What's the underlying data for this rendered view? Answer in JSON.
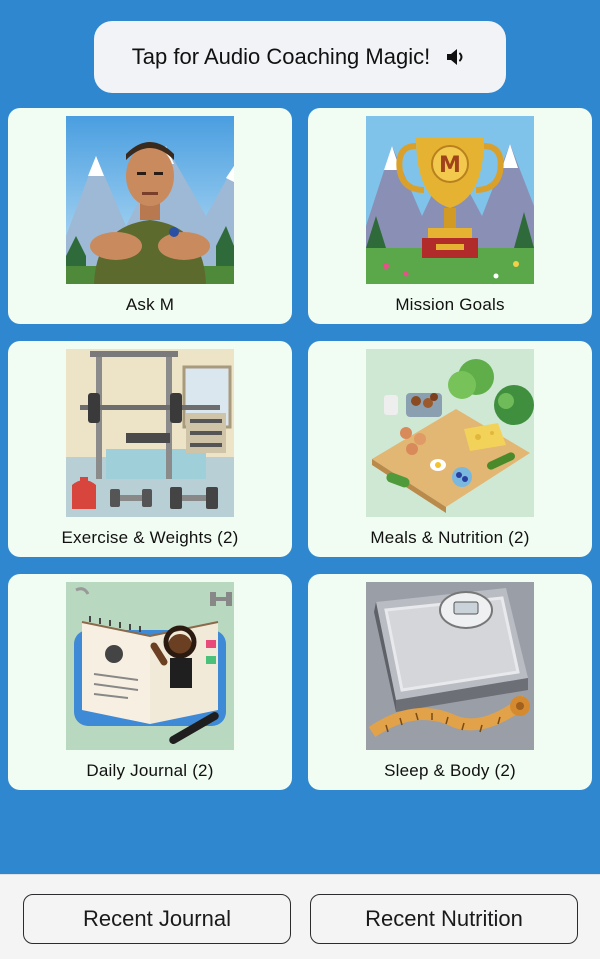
{
  "audio_button": {
    "label": "Tap for Audio Coaching Magic!",
    "icon": "speaker-icon"
  },
  "cards": [
    {
      "label": "Ask M",
      "image": "drill-sergeant-illustration"
    },
    {
      "label": "Mission Goals",
      "image": "trophy-illustration"
    },
    {
      "label": "Exercise & Weights (2)",
      "image": "gym-illustration"
    },
    {
      "label": "Meals & Nutrition (2)",
      "image": "healthy-food-illustration"
    },
    {
      "label": "Daily Journal (2)",
      "image": "journal-illustration"
    },
    {
      "label": "Sleep & Body (2)",
      "image": "scale-illustration"
    }
  ],
  "bottom_bar": {
    "recent_journal": "Recent Journal",
    "recent_nutrition": "Recent Nutrition"
  },
  "colors": {
    "background": "#2f87cf",
    "card": "#f1fcf2",
    "button": "#f1f3f6"
  }
}
